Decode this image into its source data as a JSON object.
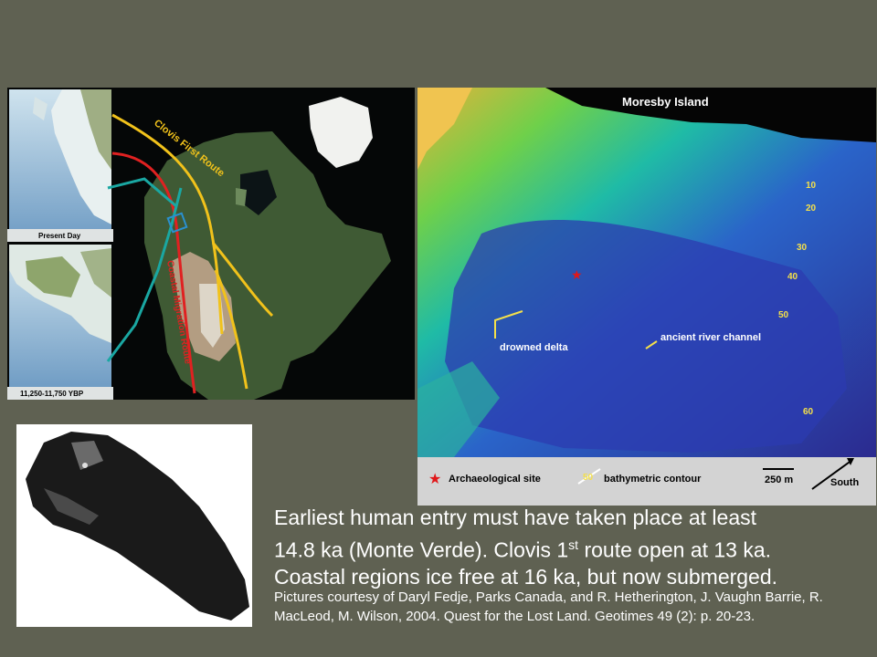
{
  "map": {
    "present_label": "Present Day",
    "past_label": "11,250-11,750 YBP",
    "clovis_route_label": "Clovis First Route",
    "coastal_route_label": "Coastal Migration Route"
  },
  "bathymetry": {
    "title": "Moresby Island",
    "drowned_delta_label": "drowned delta",
    "river_channel_label": "ancient river channel",
    "contours": [
      "10",
      "20",
      "30",
      "40",
      "50",
      "60"
    ],
    "legend": {
      "site_label": "Archaeological site",
      "contour_value": "50",
      "contour_label": "bathymetric contour",
      "scale_label": "250 m",
      "direction_label": "South"
    },
    "colors": {
      "site_star": "#e0181a"
    }
  },
  "text": {
    "line1": "Earliest human entry must have taken place at least",
    "line2_pre": "14.8 ka (Monte Verde).  Clovis 1",
    "line2_sup": "st",
    "line2_post": " route open at 13 ka.",
    "line3": "Coastal regions ice free at 16 ka, but now submerged.",
    "credit": "Pictures courtesy of Daryl Fedje, Parks Canada, and R. Hetherington, J. Vaughn Barrie, R. MacLeod, M. Wilson, 2004. Quest for the Lost Land. Geotimes 49 (2): p. 20-23."
  }
}
